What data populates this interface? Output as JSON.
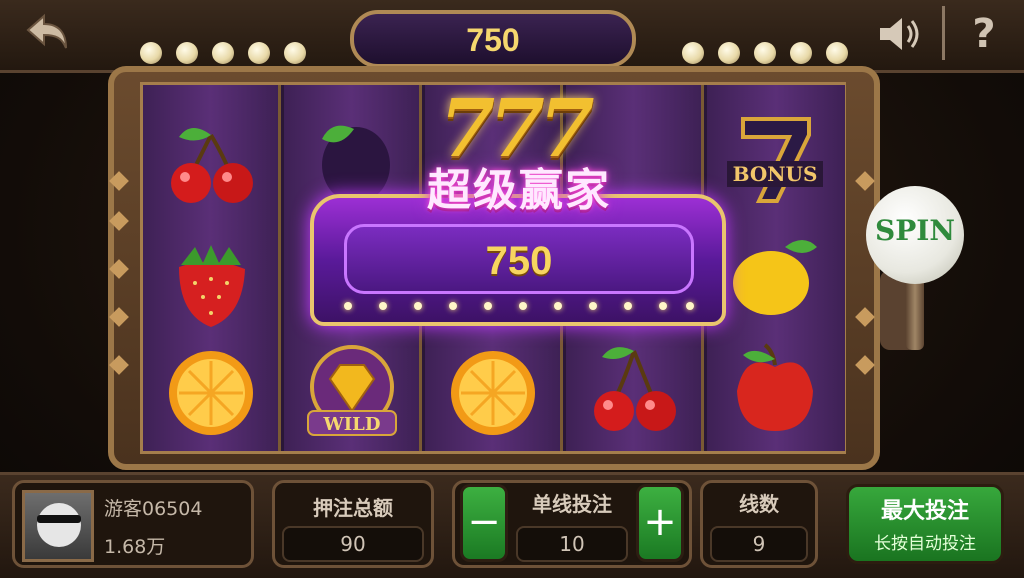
{
  "top": {
    "win_amount": "750",
    "help_label": "?"
  },
  "popup": {
    "sevens": "777",
    "title": "超级赢家",
    "value": "750"
  },
  "reels": [
    {
      "symbols": [
        "cherry-icon",
        "strawberry-icon",
        "orange-icon"
      ]
    },
    {
      "symbols": [
        "plum-icon",
        "",
        "wild-diamond-icon"
      ],
      "wild_label": "WILD"
    },
    {
      "symbols": [
        "",
        "",
        "orange-icon"
      ]
    },
    {
      "symbols": [
        "",
        "",
        "cherry-icon"
      ]
    },
    {
      "symbols": [
        "bonus-seven-icon",
        "lemon-icon",
        "apple-icon"
      ],
      "bonus_label": "BONUS"
    }
  ],
  "spin": {
    "label": "SPIN"
  },
  "player": {
    "name": "游客06504",
    "balance": "1.68万"
  },
  "bet_total": {
    "label": "押注总额",
    "value": "90"
  },
  "line_bet": {
    "label": "单线投注",
    "value": "10",
    "minus": "−",
    "plus": "+"
  },
  "lines": {
    "label": "线数",
    "value": "9"
  },
  "max_bet": {
    "title": "最大投注",
    "subtitle": "长按自动投注"
  },
  "colors": {
    "gold": "#f5d76e",
    "purple": "#5a1a9a",
    "green": "#37a83c"
  }
}
